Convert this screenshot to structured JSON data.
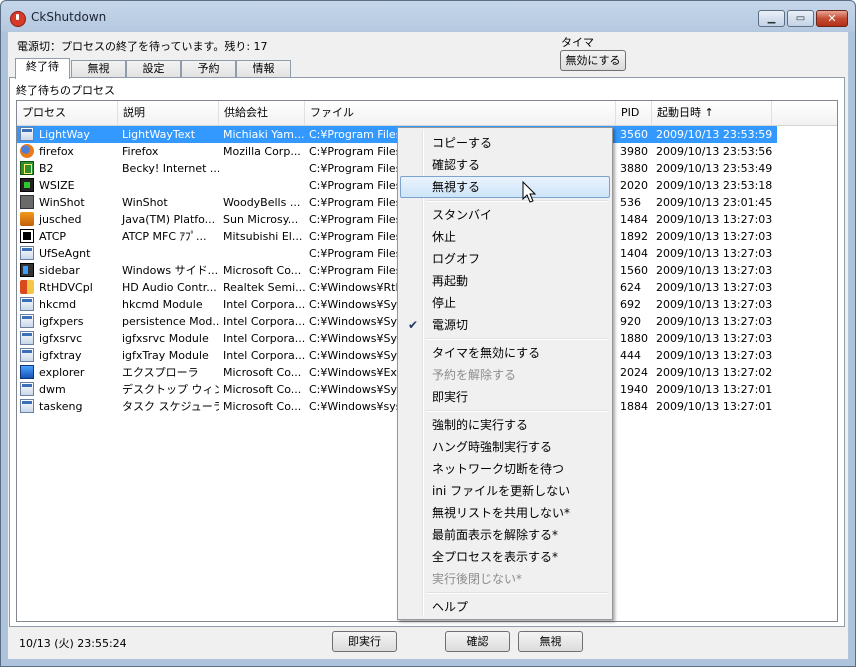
{
  "window": {
    "title": "CkShutdown"
  },
  "status": {
    "text": "電源切：プロセスの終了を待っています。残り: 17"
  },
  "timer": {
    "label": "タイマ",
    "button": "無効にする"
  },
  "tabs": [
    {
      "label": "終了待"
    },
    {
      "label": "無視"
    },
    {
      "label": "設定"
    },
    {
      "label": "予約"
    },
    {
      "label": "情報"
    }
  ],
  "panel": {
    "title": "終了待ちのプロセス"
  },
  "columns": [
    "プロセス",
    "説明",
    "供給会社",
    "ファイル",
    "PID",
    "起動日時 ↑"
  ],
  "rows": [
    {
      "name": "LightWay",
      "desc": "LightWayText",
      "vendor": "Michiaki Yam...",
      "file": "C:¥Program Files¥LightWay¥LightWayText.exe",
      "pid": "3560",
      "time": "2009/10/13 23:53:59",
      "icon": "app-window-icon"
    },
    {
      "name": "firefox",
      "desc": "Firefox",
      "vendor": "Mozilla Corp...",
      "file": "C:¥Program Files",
      "pid": "3980",
      "time": "2009/10/13 23:53:56",
      "icon": "firefox-icon"
    },
    {
      "name": "B2",
      "desc": "Becky! Internet ...",
      "vendor": "",
      "file": "C:¥Program Files",
      "pid": "3880",
      "time": "2009/10/13 23:53:49",
      "icon": "becky-icon"
    },
    {
      "name": "WSIZE",
      "desc": "",
      "vendor": "",
      "file": "C:¥Program Files",
      "pid": "2020",
      "time": "2009/10/13 23:53:18",
      "icon": "wsize-icon"
    },
    {
      "name": "WinShot",
      "desc": "WinShot",
      "vendor": "WoodyBells ...",
      "file": "C:¥Program Files",
      "pid": "536",
      "time": "2009/10/13 23:01:45",
      "icon": "winshot-icon"
    },
    {
      "name": "jusched",
      "desc": "Java(TM) Platfo...",
      "vendor": "Sun Microsy...",
      "file": "C:¥Program Files",
      "pid": "1484",
      "time": "2009/10/13 13:27:03",
      "icon": "java-icon"
    },
    {
      "name": "ATCP",
      "desc": "ATCP MFC ｱﾌﾟ...",
      "vendor": "Mitsubishi El...",
      "file": "C:¥Program Files",
      "pid": "1892",
      "time": "2009/10/13 13:27:03",
      "icon": "atcp-icon"
    },
    {
      "name": "UfSeAgnt",
      "desc": "",
      "vendor": "",
      "file": "C:¥Program Files",
      "pid": "1404",
      "time": "2009/10/13 13:27:03",
      "icon": "app-window-icon"
    },
    {
      "name": "sidebar",
      "desc": "Windows サイド...",
      "vendor": "Microsoft Co...",
      "file": "C:¥Program Files",
      "pid": "1560",
      "time": "2009/10/13 13:27:03",
      "icon": "sidebar-icon"
    },
    {
      "name": "RtHDVCpl",
      "desc": "HD Audio Contr...",
      "vendor": "Realtek Semi...",
      "file": "C:¥Windows¥RtH",
      "pid": "624",
      "time": "2009/10/13 13:27:03",
      "icon": "audio-icon"
    },
    {
      "name": "hkcmd",
      "desc": "hkcmd Module",
      "vendor": "Intel Corpora...",
      "file": "C:¥Windows¥Syst",
      "pid": "692",
      "time": "2009/10/13 13:27:03",
      "icon": "app-window-icon"
    },
    {
      "name": "igfxpers",
      "desc": "persistence Mod...",
      "vendor": "Intel Corpora...",
      "file": "C:¥Windows¥Syst",
      "pid": "920",
      "time": "2009/10/13 13:27:03",
      "icon": "app-window-icon"
    },
    {
      "name": "igfxsrvc",
      "desc": "igfxsrvc Module",
      "vendor": "Intel Corpora...",
      "file": "C:¥Windows¥Syst",
      "pid": "1880",
      "time": "2009/10/13 13:27:03",
      "icon": "app-window-icon"
    },
    {
      "name": "igfxtray",
      "desc": "igfxTray Module",
      "vendor": "Intel Corpora...",
      "file": "C:¥Windows¥Syst",
      "pid": "444",
      "time": "2009/10/13 13:27:03",
      "icon": "app-window-icon"
    },
    {
      "name": "explorer",
      "desc": "エクスプローラ",
      "vendor": "Microsoft Co...",
      "file": "C:¥Windows¥Expl",
      "pid": "2024",
      "time": "2009/10/13 13:27:02",
      "icon": "explorer-icon"
    },
    {
      "name": "dwm",
      "desc": "デスクトップ ウィン...",
      "vendor": "Microsoft Co...",
      "file": "C:¥Windows¥Syst",
      "pid": "1940",
      "time": "2009/10/13 13:27:01",
      "icon": "app-window-icon"
    },
    {
      "name": "taskeng",
      "desc": "タスク スケジューラ...",
      "vendor": "Microsoft Co...",
      "file": "C:¥Windows¥syst",
      "pid": "1884",
      "time": "2009/10/13 13:27:01",
      "icon": "app-window-icon"
    }
  ],
  "context_menu": [
    {
      "label": "コピーする",
      "state": "normal"
    },
    {
      "label": "確認する",
      "state": "normal"
    },
    {
      "label": "無視する",
      "state": "hover"
    },
    {
      "sep": true
    },
    {
      "label": "スタンバイ",
      "state": "normal"
    },
    {
      "label": "休止",
      "state": "normal"
    },
    {
      "label": "ログオフ",
      "state": "normal"
    },
    {
      "label": "再起動",
      "state": "normal"
    },
    {
      "label": "停止",
      "state": "normal"
    },
    {
      "label": "電源切",
      "state": "checked"
    },
    {
      "sep": true
    },
    {
      "label": "タイマを無効にする",
      "state": "normal"
    },
    {
      "label": "予約を解除する",
      "state": "disabled"
    },
    {
      "label": "即実行",
      "state": "normal"
    },
    {
      "sep": true
    },
    {
      "label": "強制的に実行する",
      "state": "normal"
    },
    {
      "label": "ハング時強制実行する",
      "state": "normal"
    },
    {
      "label": "ネットワーク切断を待つ",
      "state": "normal"
    },
    {
      "label": "ini ファイルを更新しない",
      "state": "normal"
    },
    {
      "label": "無視リストを共用しない*",
      "state": "normal"
    },
    {
      "label": "最前面表示を解除する*",
      "state": "normal"
    },
    {
      "label": "全プロセスを表示する*",
      "state": "normal"
    },
    {
      "label": "実行後閉じない*",
      "state": "disabled"
    },
    {
      "sep": true
    },
    {
      "label": "ヘルプ",
      "state": "normal"
    }
  ],
  "footer": {
    "datetime": "10/13 (火) 23:55:24",
    "run_now": "即実行",
    "confirm": "確認",
    "ignore": "無視"
  },
  "colors": {
    "selection": "#3399ff",
    "menu_hover": "#cde4fa",
    "titlebar": "#b6c9e0"
  }
}
